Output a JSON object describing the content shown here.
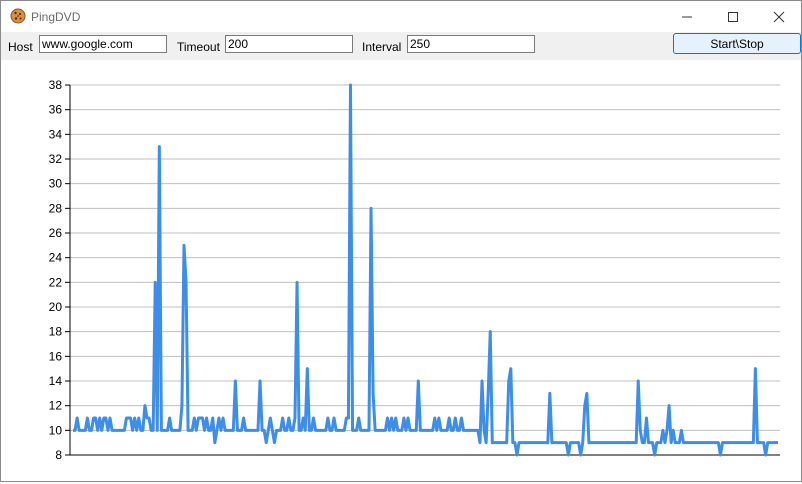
{
  "window": {
    "title": "PingDVD"
  },
  "icons": {
    "app": "cookie-icon",
    "minimize": "minimize-icon",
    "maximize": "maximize-icon",
    "close": "close-icon"
  },
  "toolbar": {
    "host_label": "Host",
    "host_value": "www.google.com",
    "timeout_label": "Timeout",
    "timeout_value": "200",
    "interval_label": "Interval",
    "interval_value": "250",
    "start_stop_label": "Start\\Stop"
  },
  "colors": {
    "series": "#3d8ee8",
    "grid": "#c0c0c0",
    "accent": "#0078d7"
  },
  "chart_data": {
    "type": "line",
    "title": "",
    "xlabel": "",
    "ylabel": "",
    "ylim": [
      8,
      38
    ],
    "yticks": [
      8,
      10,
      12,
      14,
      16,
      18,
      20,
      22,
      24,
      26,
      28,
      30,
      32,
      34,
      36,
      38
    ],
    "grid": true,
    "legend": "none",
    "series": [
      {
        "values": [
          10,
          10,
          11,
          10,
          10,
          10,
          10,
          11,
          10,
          10,
          11,
          11,
          10,
          11,
          10,
          11,
          11,
          10,
          11,
          10,
          10,
          10,
          10,
          10,
          10,
          10,
          11,
          11,
          11,
          10,
          11,
          10,
          11,
          10,
          10,
          12,
          11,
          11,
          10,
          10,
          22,
          10,
          33,
          10,
          10,
          10,
          10,
          11,
          10,
          10,
          10,
          10,
          10,
          12,
          25,
          22,
          10,
          10,
          10,
          11,
          10,
          11,
          11,
          11,
          10,
          11,
          10,
          10,
          11,
          9,
          10,
          11,
          10,
          11,
          10,
          10,
          10,
          10,
          10,
          14,
          10,
          10,
          10,
          11,
          10,
          10,
          10,
          10,
          10,
          10,
          10,
          14,
          10,
          10,
          9,
          10,
          11,
          10,
          9,
          10,
          10,
          10,
          11,
          10,
          10,
          11,
          10,
          10,
          11,
          22,
          10,
          10,
          11,
          10,
          15,
          10,
          10,
          11,
          10,
          10,
          10,
          10,
          10,
          10,
          11,
          10,
          10,
          11,
          10,
          10,
          10,
          10,
          10,
          11,
          11,
          38,
          10,
          10,
          10,
          11,
          10,
          10,
          10,
          10,
          10,
          28,
          13,
          10,
          10,
          10,
          10,
          10,
          10,
          11,
          10,
          11,
          10,
          11,
          10,
          10,
          10,
          11,
          10,
          11,
          10,
          10,
          10,
          10,
          14,
          10,
          10,
          10,
          10,
          10,
          10,
          10,
          11,
          10,
          11,
          10,
          10,
          10,
          10,
          11,
          10,
          10,
          11,
          10,
          10,
          11,
          10,
          10,
          10,
          10,
          10,
          10,
          10,
          10,
          9,
          14,
          10,
          9,
          13,
          18,
          9,
          9,
          9,
          9,
          9,
          9,
          9,
          9,
          14,
          15,
          9,
          9,
          8,
          9,
          9,
          9,
          9,
          9,
          9,
          9,
          9,
          9,
          9,
          9,
          9,
          9,
          9,
          9,
          13,
          9,
          9,
          9,
          9,
          9,
          9,
          9,
          9,
          8,
          9,
          9,
          9,
          9,
          9,
          8,
          9,
          12,
          13,
          9,
          9,
          9,
          9,
          9,
          9,
          9,
          9,
          9,
          9,
          9,
          9,
          9,
          9,
          9,
          9,
          9,
          9,
          9,
          9,
          9,
          9,
          9,
          9,
          14,
          10,
          9,
          9,
          11,
          9,
          9,
          9,
          8,
          9,
          9,
          9,
          10,
          9,
          10,
          12,
          9,
          10,
          9,
          9,
          9,
          10,
          9,
          9,
          9,
          9,
          9,
          9,
          9,
          9,
          9,
          9,
          9,
          9,
          9,
          9,
          9,
          9,
          9,
          9,
          8,
          9,
          9,
          9,
          9,
          9,
          9,
          9,
          9,
          9,
          9,
          9,
          9,
          9,
          9,
          9,
          9,
          15,
          9,
          9,
          9,
          9,
          8,
          9,
          9,
          9,
          9,
          9,
          9
        ]
      }
    ]
  }
}
